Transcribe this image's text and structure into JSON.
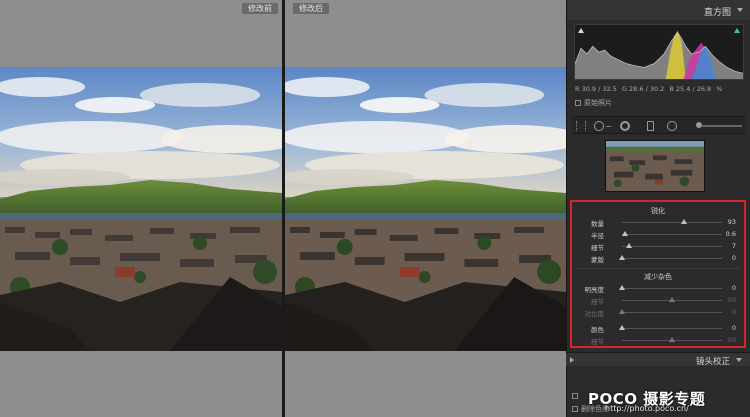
{
  "preview": {
    "before_label": "修改前",
    "after_label": "修改后"
  },
  "histogram": {
    "title": "直方图",
    "readout": {
      "r": "R 30.9 / 32.5",
      "g": "G 28.6 / 30.2",
      "b": "B 25.4 / 26.8",
      "unit": "%"
    },
    "original_photo_label": "原始照片"
  },
  "detail": {
    "sharpen": {
      "title": "锐化",
      "rows": [
        {
          "label": "数量",
          "value": "93",
          "level": 0.62
        },
        {
          "label": "半径",
          "value": "0.6",
          "level": 0.03
        },
        {
          "label": "细节",
          "value": "7",
          "level": 0.07
        },
        {
          "label": "蒙版",
          "value": "0",
          "level": 0.0
        }
      ]
    },
    "noise": {
      "title": "减少杂色",
      "rows": [
        {
          "label": "明亮度",
          "value": "0",
          "level": 0.0,
          "dim": false
        },
        {
          "label": "细节",
          "value": "50",
          "level": 0.5,
          "dim": true
        },
        {
          "label": "对比度",
          "value": "0",
          "level": 0.0,
          "dim": true
        },
        {
          "label": "颜色",
          "value": "0",
          "level": 0.0,
          "dim": false
        },
        {
          "label": "细节",
          "value": "50",
          "level": 0.5,
          "dim": true
        }
      ]
    }
  },
  "lens": {
    "title": "镜头校正",
    "row1": "",
    "row2": "删除色差"
  },
  "watermark": {
    "brand": "POCO 摄影专题",
    "url": "http://photo.poco.cn/"
  },
  "colors": {
    "highlight_box": "#d6262c",
    "histogram_bg": "#1c1c1c",
    "panel_bg": "#2b2b2b"
  }
}
